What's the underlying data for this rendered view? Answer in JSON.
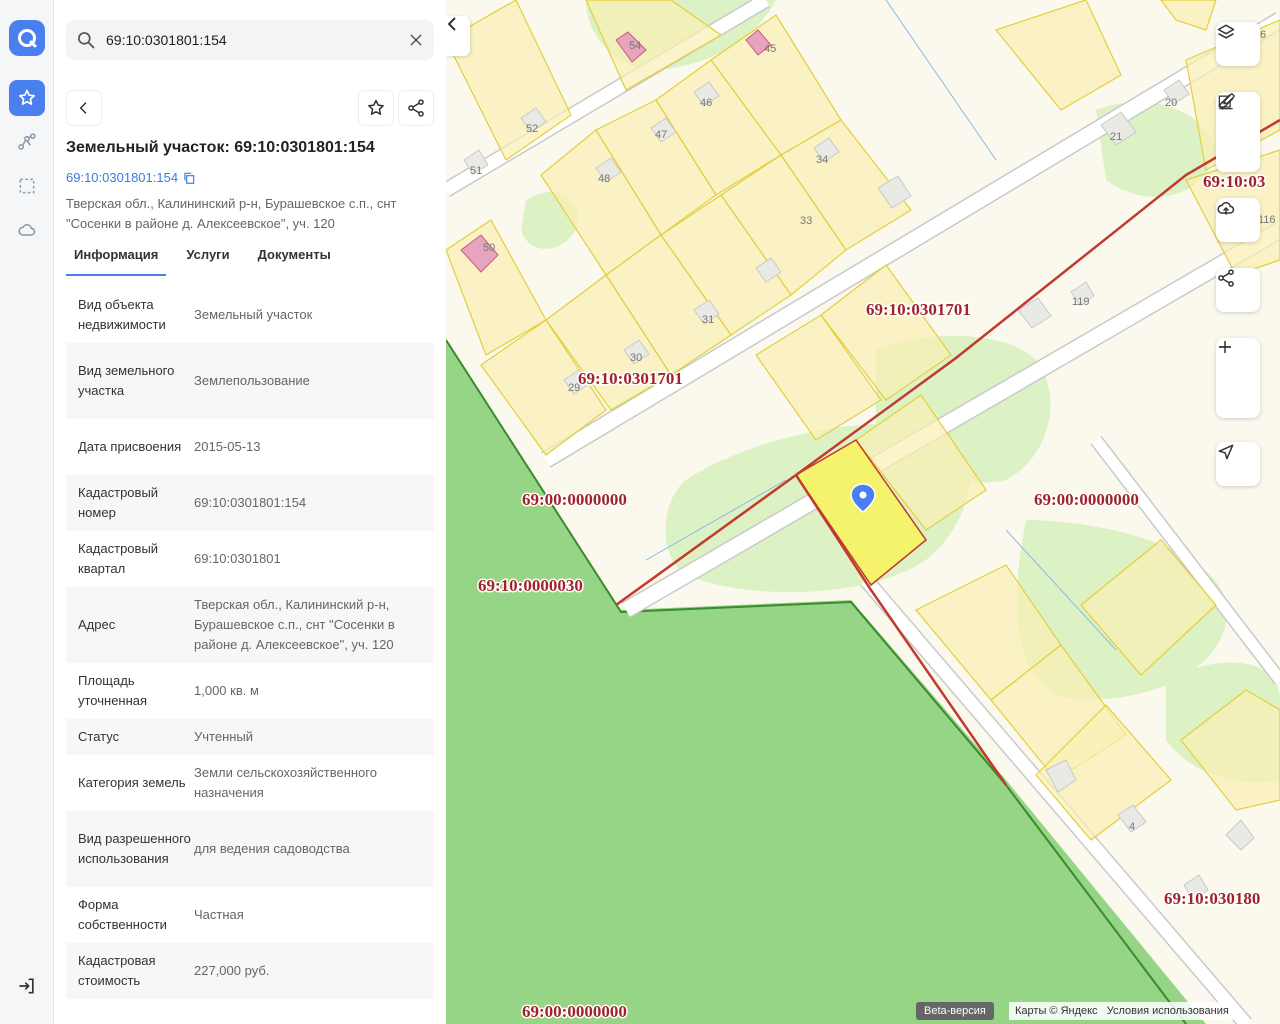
{
  "search": {
    "value": "69:10:0301801:154"
  },
  "object": {
    "title": "Земельный участок: 69:10:0301801:154",
    "cadastral_link": "69:10:0301801:154",
    "address": "Тверская обл., Калининский р-н, Бурашевское с.п., снт \"Сосенки в районе д. Алексеевское\", уч. 120"
  },
  "tabs": [
    {
      "label": "Информация",
      "active": true
    },
    {
      "label": "Услуги",
      "active": false
    },
    {
      "label": "Документы",
      "active": false
    }
  ],
  "info": [
    {
      "key": "Вид объекта недвижимости",
      "value": "Земельный участок"
    },
    {
      "key": "Вид земельного участка",
      "value": "Землепользование"
    },
    {
      "key": "Дата присвоения",
      "value": "2015-05-13"
    },
    {
      "key": "Кадастровый номер",
      "value": "69:10:0301801:154"
    },
    {
      "key": "Кадастровый квартал",
      "value": "69:10:0301801"
    },
    {
      "key": "Адрес",
      "value": "Тверская обл., Калининский р-н, Бурашевское с.п., снт \"Сосенки в районе д. Алексеевское\", уч. 120"
    },
    {
      "key": "Площадь уточненная",
      "value": "1,000 кв. м"
    },
    {
      "key": "Статус",
      "value": "Учтенный"
    },
    {
      "key": "Категория земель",
      "value": "Земли сельскохозяйственного назначения"
    },
    {
      "key": "Вид разрешенного использования",
      "value": "для ведения садоводства"
    },
    {
      "key": "Форма собственности",
      "value": "Частная"
    },
    {
      "key": "Кадастровая стоимость",
      "value": "227,000 руб."
    }
  ],
  "map": {
    "labels": {
      "q1": "69:10:0301701",
      "q2": "69:10:0301701",
      "q3": "69:00:0000000",
      "q4": "69:00:0000000",
      "q5": "69:10:0000030",
      "q6": "69:10:03",
      "q7": "69:10:030180",
      "q8": "69:00:0000000"
    },
    "lot_numbers": [
      "54",
      "45",
      "52",
      "46",
      "47",
      "51",
      "48",
      "34",
      "33",
      "50",
      "31",
      "30",
      "29",
      "20",
      "21",
      "116",
      "119",
      "4",
      "6"
    ],
    "beta_label": "Beta-версия",
    "copyright": "Карты © Яндекс",
    "terms_link": "Условия использования"
  },
  "colors": {
    "accent": "#4a7ff0",
    "cadastral_label": "#a0232b",
    "forest": "#96d585",
    "selected_lot": "#f5f36b"
  }
}
